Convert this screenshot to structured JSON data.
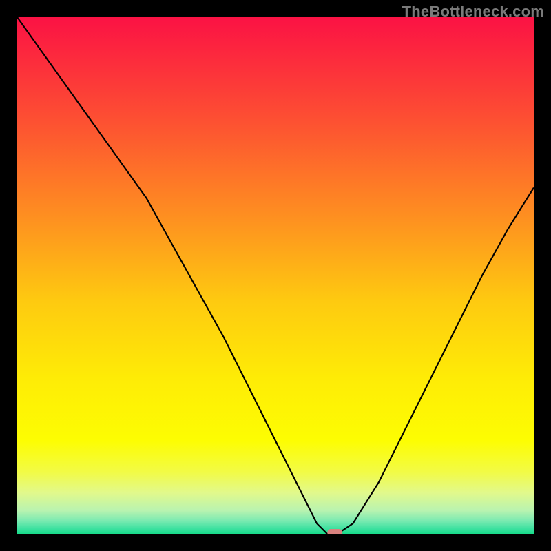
{
  "watermark": "TheBottleneck.com",
  "chart_data": {
    "type": "line",
    "title": "",
    "xlabel": "",
    "ylabel": "",
    "xlim": [
      0,
      100
    ],
    "ylim": [
      0,
      100
    ],
    "grid": false,
    "legend_position": "none",
    "series": [
      {
        "name": "bottleneck-curve",
        "x": [
          0,
          5,
          10,
          15,
          20,
          25,
          30,
          35,
          40,
          45,
          50,
          55,
          58,
          60,
          62,
          65,
          70,
          75,
          80,
          85,
          90,
          95,
          100
        ],
        "values": [
          100,
          93,
          86,
          79,
          72,
          65,
          56,
          47,
          38,
          28,
          18,
          8,
          2,
          0,
          0,
          2,
          10,
          20,
          30,
          40,
          50,
          59,
          67
        ]
      }
    ],
    "marker": {
      "name": "optimal-point",
      "x": 61.5,
      "y": 0,
      "color": "#d9817e"
    },
    "background_gradient_stops": [
      {
        "pos": 0.0,
        "color": "#fb1244"
      },
      {
        "pos": 0.2,
        "color": "#fd5032"
      },
      {
        "pos": 0.4,
        "color": "#fe941f"
      },
      {
        "pos": 0.55,
        "color": "#feca10"
      },
      {
        "pos": 0.7,
        "color": "#feec06"
      },
      {
        "pos": 0.82,
        "color": "#fdfd02"
      },
      {
        "pos": 0.88,
        "color": "#f2fb45"
      },
      {
        "pos": 0.92,
        "color": "#e2f98b"
      },
      {
        "pos": 0.955,
        "color": "#b9f3b0"
      },
      {
        "pos": 0.975,
        "color": "#7aeab1"
      },
      {
        "pos": 0.99,
        "color": "#3de1a0"
      },
      {
        "pos": 1.0,
        "color": "#18dc89"
      }
    ]
  }
}
